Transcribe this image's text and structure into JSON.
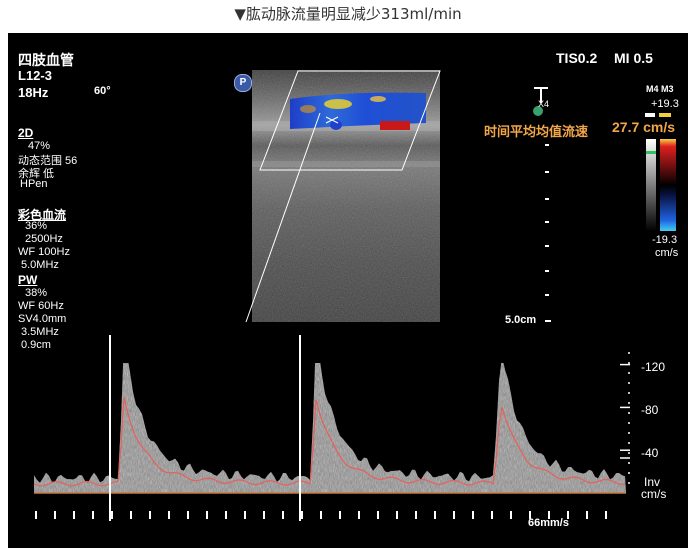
{
  "caption": "▼肱动脉流量明显减少313ml/min",
  "header": {
    "preset": "四肢血管",
    "probe": "L12-3",
    "frame_rate": "18Hz",
    "angle": "60°",
    "tis": "TIS0.2",
    "mi": "MI 0.5"
  },
  "mode_2d": {
    "title": "2D",
    "gain": "47%",
    "dynamic_range": "动态范围 56",
    "persistence": "余辉 低",
    "preset": "HPen"
  },
  "color_flow": {
    "title": "彩色血流",
    "gain": "36%",
    "prf": "2500Hz",
    "wall_filter": "WF 100Hz",
    "frequency": "5.0MHz"
  },
  "pw": {
    "title": "PW",
    "gain": "38%",
    "wall_filter": "WF  60Hz",
    "sample_volume": "SV4.0mm",
    "frequency": "3.5MHz",
    "depth": "0.9cm"
  },
  "measurement": {
    "label": "时间平均均值流速",
    "value": "27.7 cm/s"
  },
  "depth_scale": {
    "marker": "X4",
    "depth": "5.0cm"
  },
  "colorbar": {
    "map_labels": "M4 M3",
    "max": "+19.3",
    "min": "-19.3",
    "unit": "cm/s"
  },
  "doppler": {
    "ticks": [
      "-120",
      "-80",
      "-40"
    ],
    "tick_values": [
      120,
      80,
      40
    ],
    "inv": "Inv",
    "unit": "cm/s",
    "sweep": "66mm/s"
  },
  "probe_badge": "P",
  "colors": {
    "accent_orange": "#f2a64a",
    "baseline": "#c87a3c",
    "trace": "#e8605a"
  }
}
